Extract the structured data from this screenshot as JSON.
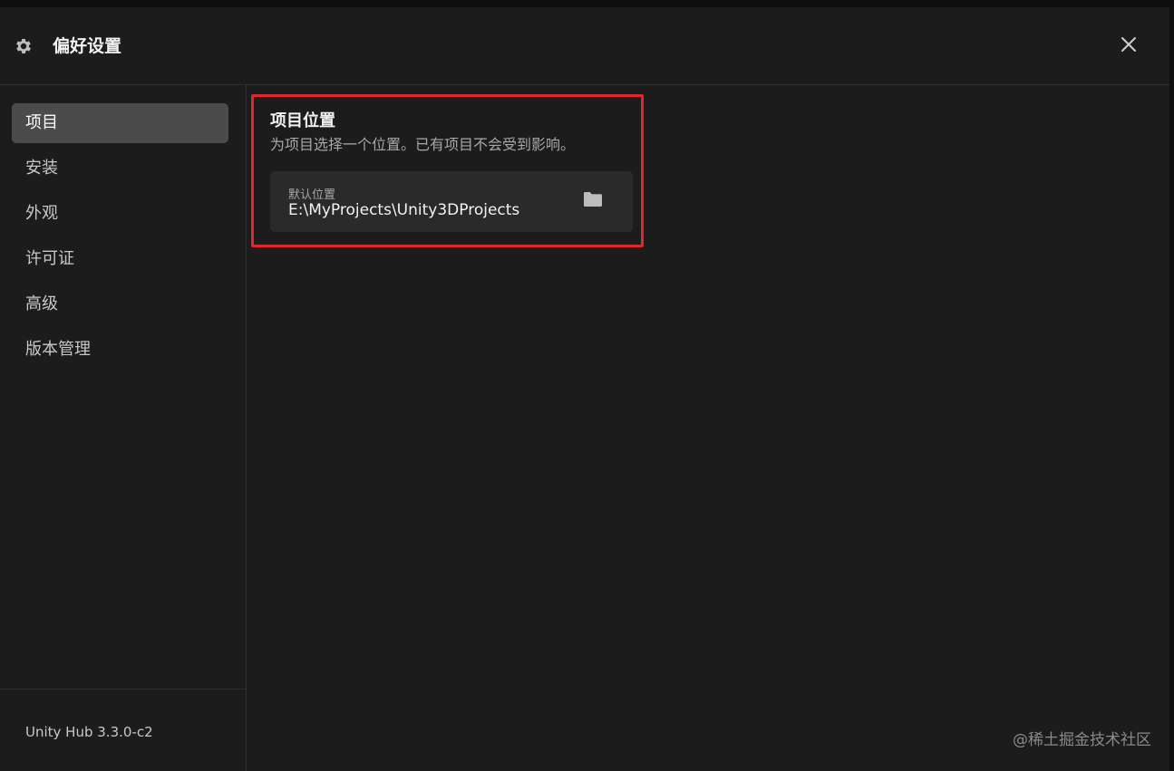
{
  "header": {
    "title": "偏好设置",
    "icon": "gear-icon"
  },
  "sidebar": {
    "items": [
      {
        "label": "项目",
        "active": true
      },
      {
        "label": "安装",
        "active": false
      },
      {
        "label": "外观",
        "active": false
      },
      {
        "label": "许可证",
        "active": false
      },
      {
        "label": "高级",
        "active": false
      },
      {
        "label": "版本管理",
        "active": false
      }
    ],
    "version": "Unity Hub 3.3.0-c2"
  },
  "main": {
    "section_title": "项目位置",
    "section_desc": "为项目选择一个位置。已有项目不会受到影响。",
    "location": {
      "label": "默认位置",
      "value": "E:\\MyProjects\\Unity3DProjects"
    }
  },
  "watermark": "@稀土掘金技术社区",
  "colors": {
    "background": "#1c1c1d",
    "active_item": "#4b4b4c",
    "highlight": "#e3262d",
    "card": "#2a2a2b"
  }
}
